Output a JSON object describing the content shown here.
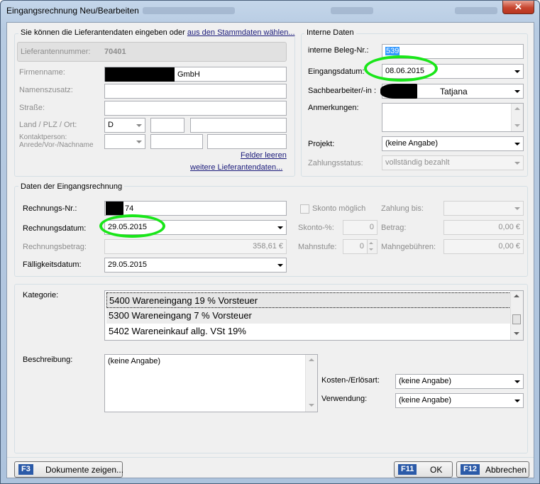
{
  "window": {
    "title": "Eingangsrechnung Neu/Bearbeiten",
    "close_glyph": "✕"
  },
  "supplier": {
    "intro_text": "Sie können die Lieferantendaten eingeben oder",
    "intro_link": "aus den Stammdaten wählen...",
    "number_label": "Lieferantennummer:",
    "number_value": "70401",
    "company_label": "Firmenname:",
    "company_value": "GmbH",
    "name_suffix_label": "Namenszusatz:",
    "street_label": "Straße:",
    "country_zip_city_label": "Land / PLZ / Ort:",
    "country_value": "D",
    "contact_label_1": "Kontaktperson:",
    "contact_label_2": "Anrede/Vor-/Nachname",
    "clear_fields_link": "Felder leeren",
    "more_data_link": "weitere Lieferantendaten..."
  },
  "internal": {
    "legend": "Interne Daten",
    "doc_number_label": "interne Beleg-Nr.:",
    "doc_number_value": "539",
    "receipt_date_label": "Eingangsdatum:",
    "receipt_date_value": "08.06.2015",
    "clerk_label": "Sachbearbeiter/-in :",
    "clerk_value": "Tatjana",
    "notes_label": "Anmerkungen:",
    "project_label": "Projekt:",
    "project_value": "(keine Angabe)",
    "payment_status_label": "Zahlungsstatus:",
    "payment_status_value": "vollständig bezahlt"
  },
  "invoice": {
    "legend": "Daten der Eingangsrechnung",
    "number_label": "Rechnungs-Nr.:",
    "number_value": "74",
    "date_label": "Rechnungsdatum:",
    "date_value": "29.05.2015",
    "amount_label": "Rechnungsbetrag:",
    "amount_value": "358,61 €",
    "due_date_label": "Fälligkeitsdatum:",
    "due_date_value": "29.05.2015",
    "skonto_possible_label": "Skonto möglich",
    "payment_until_label": "Zahlung bis:",
    "skonto_pct_label": "Skonto-%:",
    "skonto_pct_value": "0",
    "amount_short_label": "Betrag:",
    "amount_short_value": "0,00 €",
    "dunning_level_label": "Mahnstufe:",
    "dunning_level_value": "0",
    "dunning_fees_label": "Mahngebühren:",
    "dunning_fees_value": "0,00 €"
  },
  "category": {
    "label": "Kategorie:",
    "items": [
      "5400 Wareneingang 19 % Vorsteuer",
      "5300 Wareneingang 7 % Vorsteuer",
      "5402 Wareneinkauf allg. VSt 19%"
    ]
  },
  "description": {
    "label": "Beschreibung:",
    "value": "(keine Angabe)"
  },
  "cost": {
    "cost_type_label": "Kosten-/Erlösart:",
    "cost_type_value": "(keine Angabe)",
    "usage_label": "Verwendung:",
    "usage_value": "(keine Angabe)"
  },
  "footer": {
    "docs_key": "F3",
    "docs_label": "Dokumente zeigen...",
    "ok_key": "F11",
    "ok_label": "OK",
    "cancel_key": "F12",
    "cancel_label": "Abbrechen"
  }
}
